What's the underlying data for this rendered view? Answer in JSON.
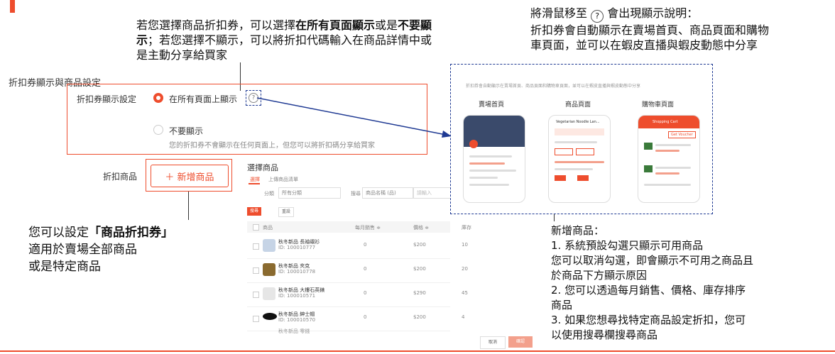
{
  "colors": {
    "accent": "#ee4d2d",
    "text": "#222222",
    "muted": "#888888",
    "dashed": "#1f3a93"
  },
  "notes": {
    "top_line1_a": "若您選擇商品折扣券，可以選擇",
    "top_line1_b": "在所有頁面顯示",
    "top_line1_c": "或是",
    "top_line1_d": "不要顯",
    "top_line2_a": "示",
    "top_line2_b": "；若您選擇不顯示，可以將折扣代碼輸入在商品詳情中或",
    "top_line3": "是主動分享給買家",
    "right_line1_a": "將滑鼠移至",
    "right_line1_b": "會出現顯示說明：",
    "right_line2": "折扣券會自動顯示在賣場首頁、商品頁面和購物",
    "right_line3": "車頁面，並可以在蝦皮直播與蝦皮動態中分享",
    "left_line1_a": "您可以設定",
    "left_line1_b": "「商品折扣券」",
    "left_line2": "適用於賣場全部商品",
    "left_line3": "或是特定商品",
    "br_lines": [
      "新增商品：",
      "1. 系統預設勾選只顯示可用商品",
      "您可以取消勾選，即會顯示不可用之商品且",
      "於商品下方顯示原因",
      "2. 您可以透過每月銷售、價格、庫存排序",
      "商品",
      "3. 如果您想尋找特定商品設定折扣，您可",
      "以使用搜尋欄搜尋商品"
    ]
  },
  "form": {
    "section_title": "折扣券顯示與商品設定",
    "display_label": "折扣券顯示設定",
    "opt_all": "在所有頁面上顯示",
    "opt_none": "不要顯示",
    "opt_none_desc": "您的折扣券不會顯示在任何頁面上，但您可以將折扣碼分享給買家",
    "products_label": "折扣商品",
    "add_button": "＋ 新增商品"
  },
  "modal": {
    "title": "選擇商品",
    "tab_select": "選擇",
    "tab_upload": "上傳商品清單",
    "filter_category_label": "分類",
    "filter_category_value": "所有分類",
    "search_label": "搜尋",
    "search_field": "商品名稱 (品)",
    "search_placeholder": "請輸入",
    "search_btn": "搜尋",
    "reset_btn": "重設",
    "headers": [
      "商品",
      "每月銷售 ≑",
      "價格 ≑",
      "庫存"
    ],
    "rows": [
      {
        "name": "秋冬新品 長袖襯衫",
        "id": "ID: 100010777",
        "sales": "0",
        "price": "$200",
        "stock": "10"
      },
      {
        "name": "秋冬新品 夾克",
        "id": "ID: 100010778",
        "sales": "0",
        "price": "$200",
        "stock": "20"
      },
      {
        "name": "秋冬新品 大樓石英錶",
        "id": "ID: 100010571",
        "sales": "0",
        "price": "$290",
        "stock": "45"
      },
      {
        "name": "秋冬新品 紳士帽",
        "id": "ID: 100010570",
        "sales": "0",
        "price": "$200",
        "stock": "4"
      },
      {
        "name": "秋冬新品 零錢",
        "id": "",
        "sales": "",
        "price": "",
        "stock": ""
      }
    ],
    "cancel_btn": "取消",
    "confirm_btn": "確認"
  },
  "preview": {
    "caption": "折扣券會自動顯示在賣場首頁、商品頁面和購物車頁面，並可以在蝦皮直播與蝦皮動態中分享",
    "labels": [
      "賣場首頁",
      "商品頁面",
      "購物車頁面"
    ],
    "phone2_title": "Vegetarian Noodle Lan...",
    "phone3_title": "Shopping Cart",
    "phone3_badge": "Get Voucher"
  }
}
